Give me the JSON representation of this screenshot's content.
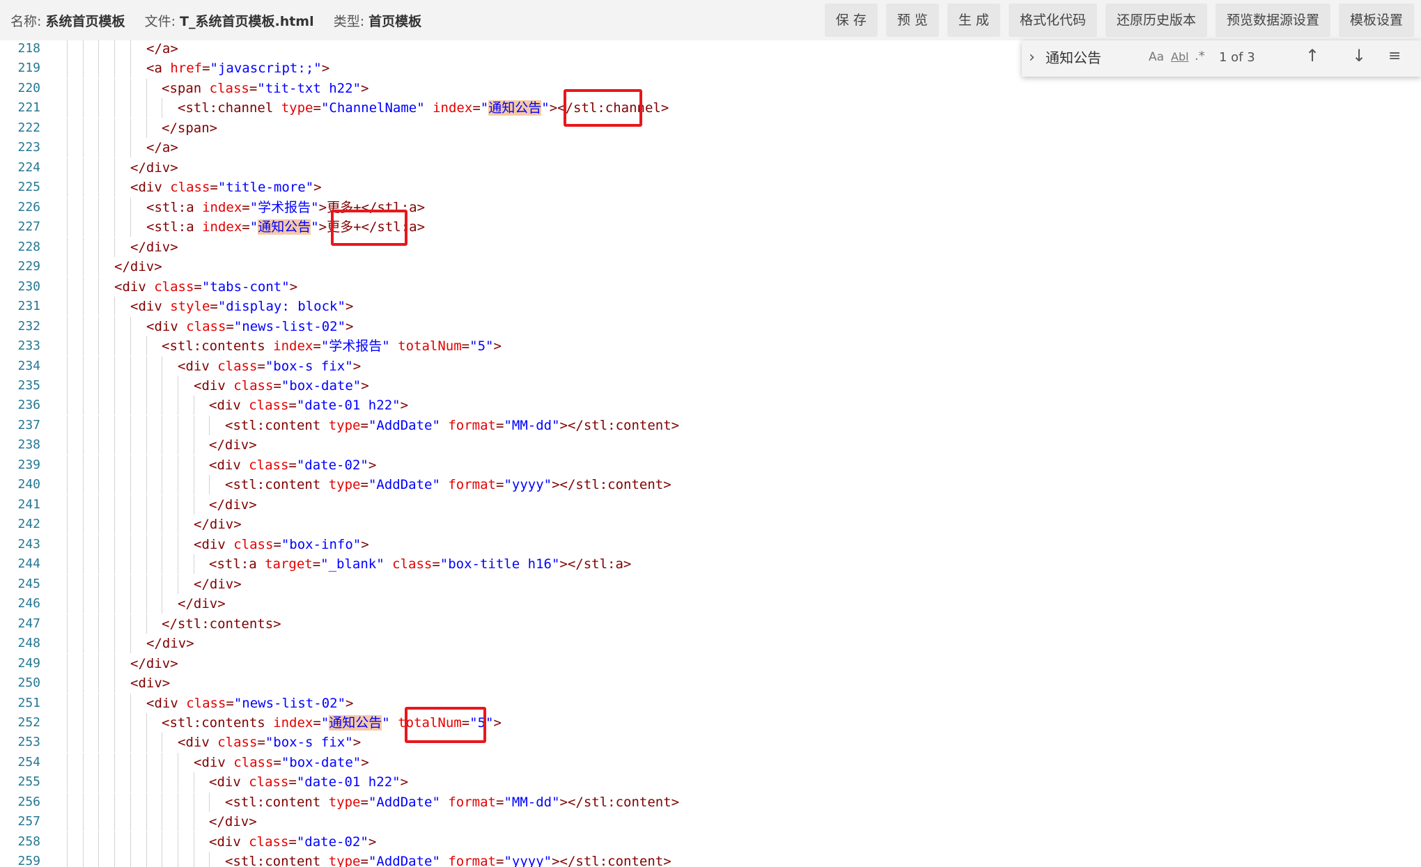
{
  "header": {
    "name_label": "名称:",
    "name_value": "系统首页模板",
    "file_label": "文件:",
    "file_value": "T_系统首页模板.html",
    "type_label": "类型:",
    "type_value": "首页模板"
  },
  "toolbar": {
    "buttons": [
      "保 存",
      "预 览",
      "生 成",
      "格式化代码",
      "还原历史版本",
      "预览数据源设置",
      "模板设置"
    ]
  },
  "find": {
    "query": "通知公告",
    "match_case": "Aa",
    "whole_word": "Abl",
    "regex": ".*",
    "count": "1 of 3"
  },
  "colors": {
    "tag": "#800000",
    "attr": "#e50000",
    "value": "#0000ff",
    "line_number": "#237893",
    "find_highlight": "#f6c9a5",
    "annotation_box": "#e8171c"
  },
  "editor": {
    "lines": [
      {
        "n": "218",
        "indent": 10,
        "segs": [
          [
            "t",
            "</a>"
          ]
        ]
      },
      {
        "n": "219",
        "indent": 10,
        "segs": [
          [
            "t",
            "<a "
          ],
          [
            "a",
            "href"
          ],
          [
            "t",
            "="
          ],
          [
            "v",
            "\"javascript:;\""
          ],
          [
            "t",
            ">"
          ]
        ]
      },
      {
        "n": "220",
        "indent": 12,
        "segs": [
          [
            "t",
            "<span "
          ],
          [
            "a",
            "class"
          ],
          [
            "t",
            "="
          ],
          [
            "v",
            "\"tit-txt h22\""
          ],
          [
            "t",
            ">"
          ]
        ]
      },
      {
        "n": "221",
        "indent": 14,
        "segs": [
          [
            "t",
            "<stl:channel "
          ],
          [
            "a",
            "type"
          ],
          [
            "t",
            "="
          ],
          [
            "v",
            "\"ChannelName\""
          ],
          [
            "t",
            " "
          ],
          [
            "a",
            "index"
          ],
          [
            "t",
            "="
          ],
          [
            "v",
            "\""
          ],
          [
            "h",
            "通知公告"
          ],
          [
            "v",
            "\""
          ],
          [
            "t",
            "></stl:channel>"
          ]
        ]
      },
      {
        "n": "222",
        "indent": 12,
        "segs": [
          [
            "t",
            "</span>"
          ]
        ]
      },
      {
        "n": "223",
        "indent": 10,
        "segs": [
          [
            "t",
            "</a>"
          ]
        ]
      },
      {
        "n": "224",
        "indent": 8,
        "segs": [
          [
            "t",
            "</div>"
          ]
        ]
      },
      {
        "n": "225",
        "indent": 8,
        "segs": [
          [
            "t",
            "<div "
          ],
          [
            "a",
            "class"
          ],
          [
            "t",
            "="
          ],
          [
            "v",
            "\"title-more\""
          ],
          [
            "t",
            ">"
          ]
        ]
      },
      {
        "n": "226",
        "indent": 10,
        "segs": [
          [
            "t",
            "<stl:a "
          ],
          [
            "a",
            "index"
          ],
          [
            "t",
            "="
          ],
          [
            "v",
            "\"学术报告\""
          ],
          [
            "t",
            ">更多+</stl:a>"
          ]
        ]
      },
      {
        "n": "227",
        "indent": 10,
        "segs": [
          [
            "t",
            "<stl:a "
          ],
          [
            "a",
            "index"
          ],
          [
            "t",
            "="
          ],
          [
            "v",
            "\""
          ],
          [
            "h",
            "通知公告"
          ],
          [
            "v",
            "\""
          ],
          [
            "t",
            ">更多+</stl:a>"
          ]
        ]
      },
      {
        "n": "228",
        "indent": 8,
        "segs": [
          [
            "t",
            "</div>"
          ]
        ]
      },
      {
        "n": "229",
        "indent": 6,
        "segs": [
          [
            "t",
            "</div>"
          ]
        ]
      },
      {
        "n": "230",
        "indent": 6,
        "segs": [
          [
            "t",
            "<div "
          ],
          [
            "a",
            "class"
          ],
          [
            "t",
            "="
          ],
          [
            "v",
            "\"tabs-cont\""
          ],
          [
            "t",
            ">"
          ]
        ]
      },
      {
        "n": "231",
        "indent": 8,
        "segs": [
          [
            "t",
            "<div "
          ],
          [
            "a",
            "style"
          ],
          [
            "t",
            "="
          ],
          [
            "v",
            "\"display: block\""
          ],
          [
            "t",
            ">"
          ]
        ]
      },
      {
        "n": "232",
        "indent": 10,
        "segs": [
          [
            "t",
            "<div "
          ],
          [
            "a",
            "class"
          ],
          [
            "t",
            "="
          ],
          [
            "v",
            "\"news-list-02\""
          ],
          [
            "t",
            ">"
          ]
        ]
      },
      {
        "n": "233",
        "indent": 12,
        "segs": [
          [
            "t",
            "<stl:contents "
          ],
          [
            "a",
            "index"
          ],
          [
            "t",
            "="
          ],
          [
            "v",
            "\"学术报告\""
          ],
          [
            "t",
            " "
          ],
          [
            "a",
            "totalNum"
          ],
          [
            "t",
            "="
          ],
          [
            "v",
            "\"5\""
          ],
          [
            "t",
            ">"
          ]
        ]
      },
      {
        "n": "234",
        "indent": 14,
        "segs": [
          [
            "t",
            "<div "
          ],
          [
            "a",
            "class"
          ],
          [
            "t",
            "="
          ],
          [
            "v",
            "\"box-s fix\""
          ],
          [
            "t",
            ">"
          ]
        ]
      },
      {
        "n": "235",
        "indent": 16,
        "segs": [
          [
            "t",
            "<div "
          ],
          [
            "a",
            "class"
          ],
          [
            "t",
            "="
          ],
          [
            "v",
            "\"box-date\""
          ],
          [
            "t",
            ">"
          ]
        ]
      },
      {
        "n": "236",
        "indent": 18,
        "segs": [
          [
            "t",
            "<div "
          ],
          [
            "a",
            "class"
          ],
          [
            "t",
            "="
          ],
          [
            "v",
            "\"date-01 h22\""
          ],
          [
            "t",
            ">"
          ]
        ]
      },
      {
        "n": "237",
        "indent": 20,
        "segs": [
          [
            "t",
            "<stl:content "
          ],
          [
            "a",
            "type"
          ],
          [
            "t",
            "="
          ],
          [
            "v",
            "\"AddDate\""
          ],
          [
            "t",
            " "
          ],
          [
            "a",
            "format"
          ],
          [
            "t",
            "="
          ],
          [
            "v",
            "\"MM-dd\""
          ],
          [
            "t",
            "></stl:content>"
          ]
        ]
      },
      {
        "n": "238",
        "indent": 18,
        "segs": [
          [
            "t",
            "</div>"
          ]
        ]
      },
      {
        "n": "239",
        "indent": 18,
        "segs": [
          [
            "t",
            "<div "
          ],
          [
            "a",
            "class"
          ],
          [
            "t",
            "="
          ],
          [
            "v",
            "\"date-02\""
          ],
          [
            "t",
            ">"
          ]
        ]
      },
      {
        "n": "240",
        "indent": 20,
        "segs": [
          [
            "t",
            "<stl:content "
          ],
          [
            "a",
            "type"
          ],
          [
            "t",
            "="
          ],
          [
            "v",
            "\"AddDate\""
          ],
          [
            "t",
            " "
          ],
          [
            "a",
            "format"
          ],
          [
            "t",
            "="
          ],
          [
            "v",
            "\"yyyy\""
          ],
          [
            "t",
            "></stl:content>"
          ]
        ]
      },
      {
        "n": "241",
        "indent": 18,
        "segs": [
          [
            "t",
            "</div>"
          ]
        ]
      },
      {
        "n": "242",
        "indent": 16,
        "segs": [
          [
            "t",
            "</div>"
          ]
        ]
      },
      {
        "n": "243",
        "indent": 16,
        "segs": [
          [
            "t",
            "<div "
          ],
          [
            "a",
            "class"
          ],
          [
            "t",
            "="
          ],
          [
            "v",
            "\"box-info\""
          ],
          [
            "t",
            ">"
          ]
        ]
      },
      {
        "n": "244",
        "indent": 18,
        "segs": [
          [
            "t",
            "<stl:a "
          ],
          [
            "a",
            "target"
          ],
          [
            "t",
            "="
          ],
          [
            "v",
            "\"_blank\""
          ],
          [
            "t",
            " "
          ],
          [
            "a",
            "class"
          ],
          [
            "t",
            "="
          ],
          [
            "v",
            "\"box-title h16\""
          ],
          [
            "t",
            "></stl:a>"
          ]
        ]
      },
      {
        "n": "245",
        "indent": 16,
        "segs": [
          [
            "t",
            "</div>"
          ]
        ]
      },
      {
        "n": "246",
        "indent": 14,
        "segs": [
          [
            "t",
            "</div>"
          ]
        ]
      },
      {
        "n": "247",
        "indent": 12,
        "segs": [
          [
            "t",
            "</stl:contents>"
          ]
        ]
      },
      {
        "n": "248",
        "indent": 10,
        "segs": [
          [
            "t",
            "</div>"
          ]
        ]
      },
      {
        "n": "249",
        "indent": 8,
        "segs": [
          [
            "t",
            "</div>"
          ]
        ]
      },
      {
        "n": "250",
        "indent": 8,
        "segs": [
          [
            "t",
            "<div>"
          ]
        ]
      },
      {
        "n": "251",
        "indent": 10,
        "segs": [
          [
            "t",
            "<div "
          ],
          [
            "a",
            "class"
          ],
          [
            "t",
            "="
          ],
          [
            "v",
            "\"news-list-02\""
          ],
          [
            "t",
            ">"
          ]
        ]
      },
      {
        "n": "252",
        "indent": 12,
        "segs": [
          [
            "t",
            "<stl:contents "
          ],
          [
            "a",
            "index"
          ],
          [
            "t",
            "="
          ],
          [
            "v",
            "\""
          ],
          [
            "h",
            "通知公告"
          ],
          [
            "v",
            "\""
          ],
          [
            "t",
            " "
          ],
          [
            "a",
            "totalNum"
          ],
          [
            "t",
            "="
          ],
          [
            "v",
            "\"5\""
          ],
          [
            "t",
            ">"
          ]
        ]
      },
      {
        "n": "253",
        "indent": 14,
        "segs": [
          [
            "t",
            "<div "
          ],
          [
            "a",
            "class"
          ],
          [
            "t",
            "="
          ],
          [
            "v",
            "\"box-s fix\""
          ],
          [
            "t",
            ">"
          ]
        ]
      },
      {
        "n": "254",
        "indent": 16,
        "segs": [
          [
            "t",
            "<div "
          ],
          [
            "a",
            "class"
          ],
          [
            "t",
            "="
          ],
          [
            "v",
            "\"box-date\""
          ],
          [
            "t",
            ">"
          ]
        ]
      },
      {
        "n": "255",
        "indent": 18,
        "segs": [
          [
            "t",
            "<div "
          ],
          [
            "a",
            "class"
          ],
          [
            "t",
            "="
          ],
          [
            "v",
            "\"date-01 h22\""
          ],
          [
            "t",
            ">"
          ]
        ]
      },
      {
        "n": "256",
        "indent": 20,
        "segs": [
          [
            "t",
            "<stl:content "
          ],
          [
            "a",
            "type"
          ],
          [
            "t",
            "="
          ],
          [
            "v",
            "\"AddDate\""
          ],
          [
            "t",
            " "
          ],
          [
            "a",
            "format"
          ],
          [
            "t",
            "="
          ],
          [
            "v",
            "\"MM-dd\""
          ],
          [
            "t",
            "></stl:content>"
          ]
        ]
      },
      {
        "n": "257",
        "indent": 18,
        "segs": [
          [
            "t",
            "</div>"
          ]
        ]
      },
      {
        "n": "258",
        "indent": 18,
        "segs": [
          [
            "t",
            "<div "
          ],
          [
            "a",
            "class"
          ],
          [
            "t",
            "="
          ],
          [
            "v",
            "\"date-02\""
          ],
          [
            "t",
            ">"
          ]
        ]
      },
      {
        "n": "259",
        "indent": 20,
        "segs": [
          [
            "t",
            "<stl:content "
          ],
          [
            "a",
            "type"
          ],
          [
            "t",
            "="
          ],
          [
            "v",
            "\"AddDate\""
          ],
          [
            "t",
            " "
          ],
          [
            "a",
            "format"
          ],
          [
            "t",
            "="
          ],
          [
            "v",
            "\"yyyy\""
          ],
          [
            "t",
            "></stl:content>"
          ]
        ]
      }
    ]
  }
}
